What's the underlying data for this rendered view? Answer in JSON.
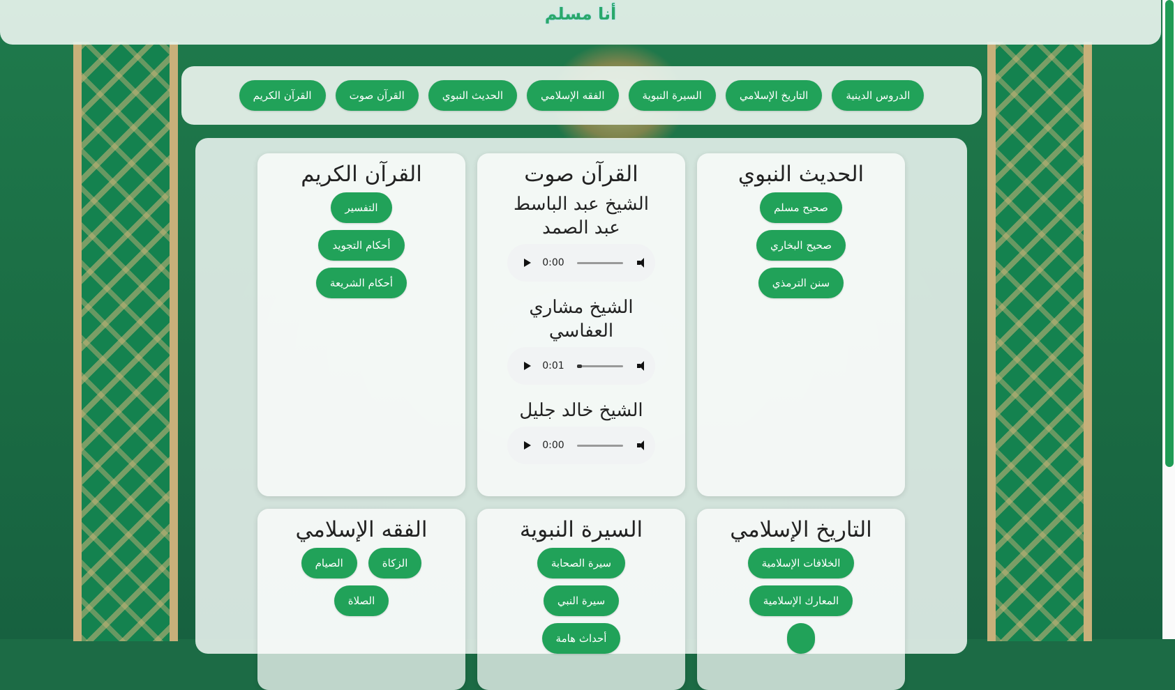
{
  "site": {
    "title": "أنا مسلم"
  },
  "nav": {
    "items": [
      "الدروس الدينية",
      "التاريخ الإسلامي",
      "السيرة النبوية",
      "الفقه الإسلامي",
      "الحديث النبوي",
      "القرآن صوت",
      "القرآن الكريم"
    ]
  },
  "cards": {
    "quran": {
      "title": "القرآن الكريم",
      "buttons": [
        "التفسير",
        "أحكام التجويد",
        "أحكام الشريعة"
      ]
    },
    "audio": {
      "title": "القرآن صوت",
      "reciters": [
        {
          "name": "الشيخ عبد الباسط عبد الصمد",
          "time": "0:00",
          "progress": 0
        },
        {
          "name": "الشيخ مشاري العفاسي",
          "time": "0:01",
          "progress": 0.1
        },
        {
          "name": "الشيخ خالد جليل",
          "time": "0:00",
          "progress": 0
        }
      ]
    },
    "hadith": {
      "title": "الحديث النبوي",
      "buttons": [
        "صحيح مسلم",
        "صحيح البخاري",
        "سنن الترمذي"
      ]
    },
    "fiqh": {
      "title": "الفقه الإسلامي",
      "buttons": [
        "الزكاة",
        "الصيام",
        "الصلاة"
      ]
    },
    "seerah": {
      "title": "السيرة النبوية",
      "buttons": [
        "سيرة الصحابة",
        "سيرة النبي",
        "أحداث هامة"
      ]
    },
    "history": {
      "title": "التاريخ الإسلامي",
      "buttons": [
        "الخلافات الإسلامية",
        "المعارك الإسلامية"
      ]
    }
  },
  "colors": {
    "accent": "#21a259",
    "background": "#1c6b45"
  }
}
